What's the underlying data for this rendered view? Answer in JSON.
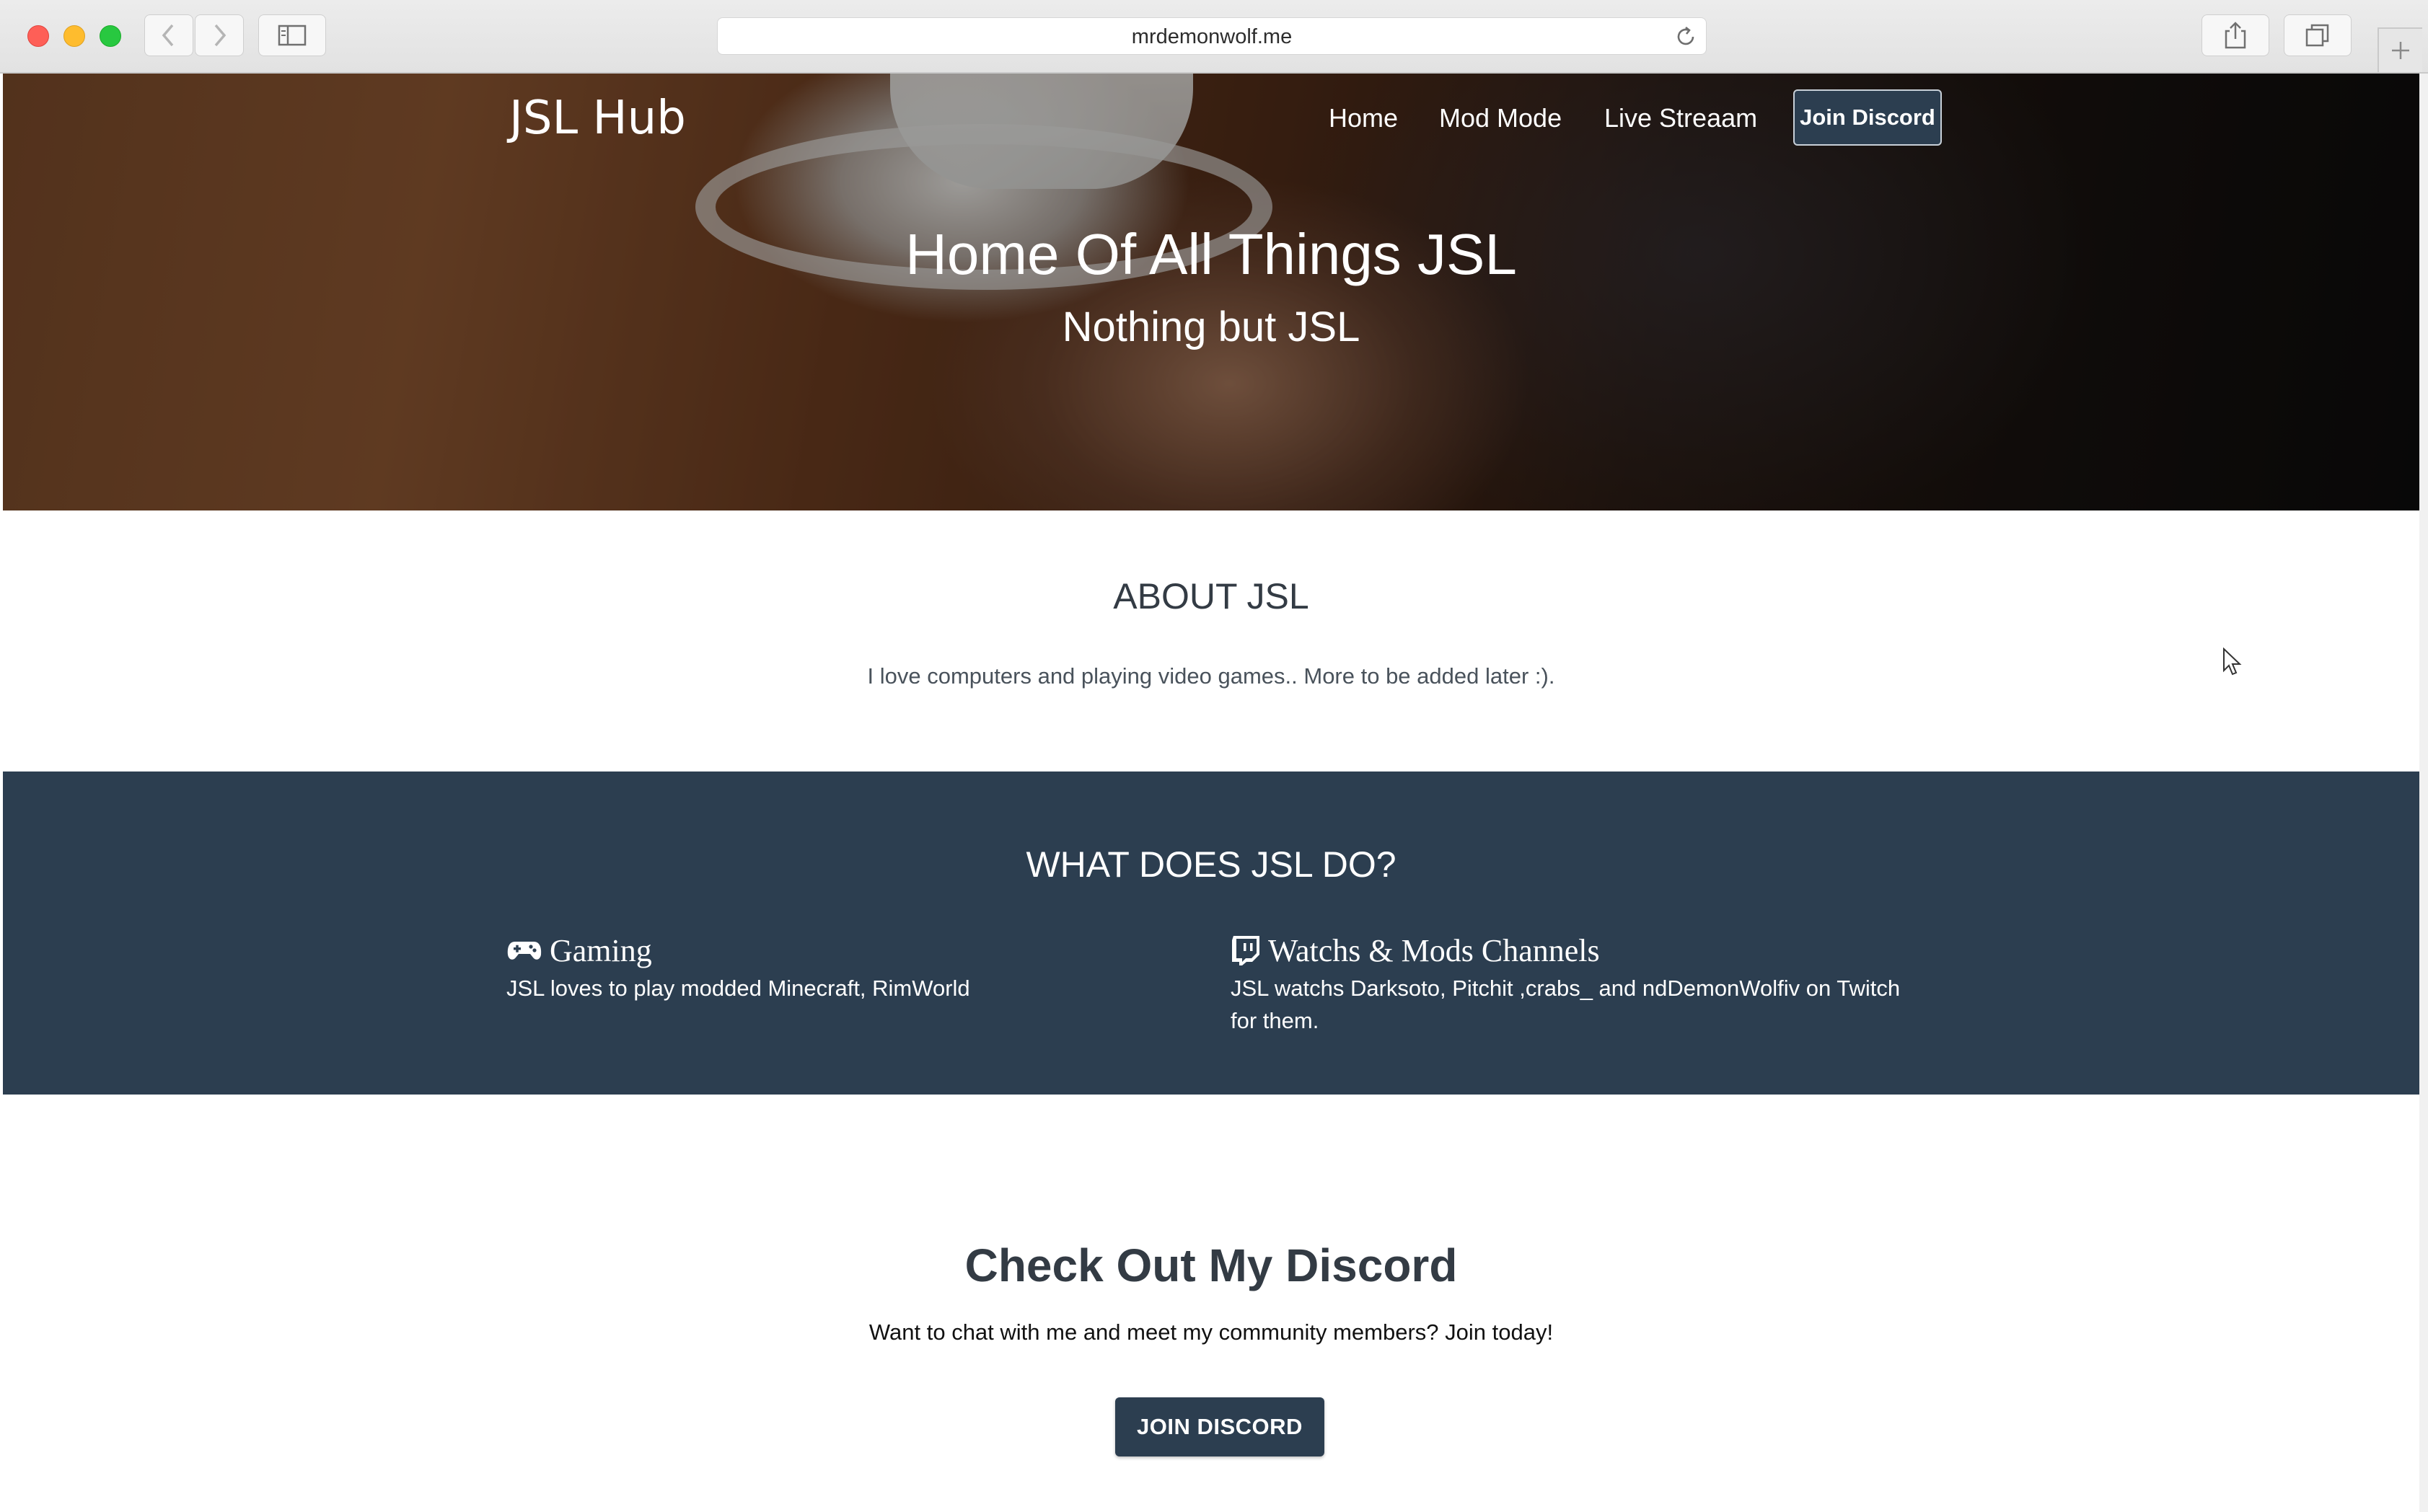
{
  "browser": {
    "url": "mrdemonwolf.me",
    "icons": {
      "back": "chevron-left-icon",
      "forward": "chevron-right-icon",
      "sidebar": "sidebar-icon",
      "reload": "reload-icon",
      "share": "share-icon",
      "tabs": "tabs-overview-icon",
      "new_tab": "plus-icon"
    }
  },
  "navbar": {
    "brand": "JSL Hub",
    "links": [
      "Home",
      "Mod Mode",
      "Live Streaam"
    ],
    "cta": "Join Discord"
  },
  "hero": {
    "title": "Home Of All Things JSL",
    "subtitle": "Nothing but JSL"
  },
  "about": {
    "title": "ABOUT JSL",
    "text": "I love computers and playing video games.. More to be added later :)."
  },
  "what": {
    "title": "WHAT DOES JSL DO?",
    "features": [
      {
        "icon": "gamepad-icon",
        "title": "Gaming",
        "text": "JSL loves to play modded Minecraft, RimWorld"
      },
      {
        "icon": "twitch-icon",
        "title": "Watchs & Mods Channels",
        "text": "JSL watchs Darksoto, Pitchit ,crabs_ and ndDemonWolfiv on Twitch for them."
      }
    ]
  },
  "discord": {
    "title": "Check Out My Discord",
    "text": "Want to chat with me and meet my community members? Join today!",
    "button": "JOIN DISCORD"
  },
  "colors": {
    "primary": "#2c3e50",
    "heading": "#333b44",
    "white": "#ffffff"
  }
}
